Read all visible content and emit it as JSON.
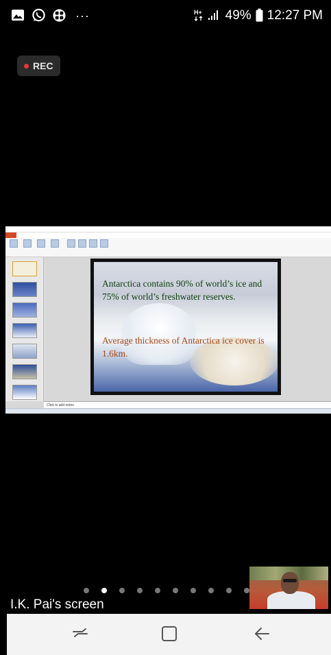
{
  "status_bar": {
    "left_icons": [
      "gallery-icon",
      "whatsapp-icon",
      "app-icon"
    ],
    "more": "···",
    "battery_percent": "49%",
    "time": "12:27 PM"
  },
  "recording": {
    "label": "REC"
  },
  "shared_screen": {
    "notes_placeholder": "Click to add notes",
    "slide": {
      "text_main": "Antarctica contains 90% of world’s ice and 75% of world’s freshwater reserves.",
      "text_secondary": "Average thickness of Antarctica ice cover is 1.6km."
    }
  },
  "meeting": {
    "screen_owner_label": "I.K. Pai's screen",
    "page_count": 10,
    "active_page": 2
  },
  "navigation": {
    "recents": "recents-icon",
    "home": "home-icon",
    "back": "back-icon"
  }
}
